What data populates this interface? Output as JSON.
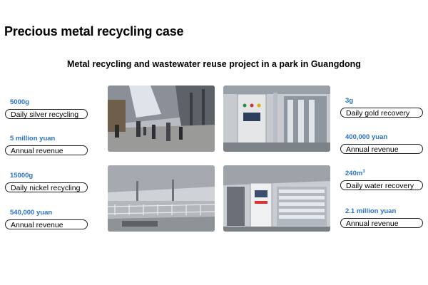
{
  "title": "Precious metal recycling case",
  "subtitle": "Metal recycling and wastewater reuse project in a park in Guangdong",
  "left_stats": [
    {
      "value": "5000g",
      "label": "Daily silver recycling"
    },
    {
      "value": "5 million yuan",
      "label": "Annual revenue"
    },
    {
      "value": "15000g",
      "label": "Daily nickel recycling"
    },
    {
      "value": "540,000 yuan",
      "label": "Annual revenue"
    }
  ],
  "right_stats": [
    {
      "value": "3g",
      "label": "Daily gold recovery"
    },
    {
      "value": "400,000 yuan",
      "label": "Annual revenue"
    },
    {
      "value": "240m",
      "value_sup": "3",
      "label": "Daily water recovery"
    },
    {
      "value": "2.1 million yuan",
      "label": "Annual revenue"
    }
  ],
  "photos": [
    {
      "name": "factory-walkway-photo"
    },
    {
      "name": "control-cabinet-photo"
    },
    {
      "name": "treatment-tanks-photo"
    },
    {
      "name": "membrane-equipment-photo"
    }
  ],
  "colors": {
    "accent": "#2a73c9",
    "text": "#000000",
    "background": "#ffffff"
  }
}
